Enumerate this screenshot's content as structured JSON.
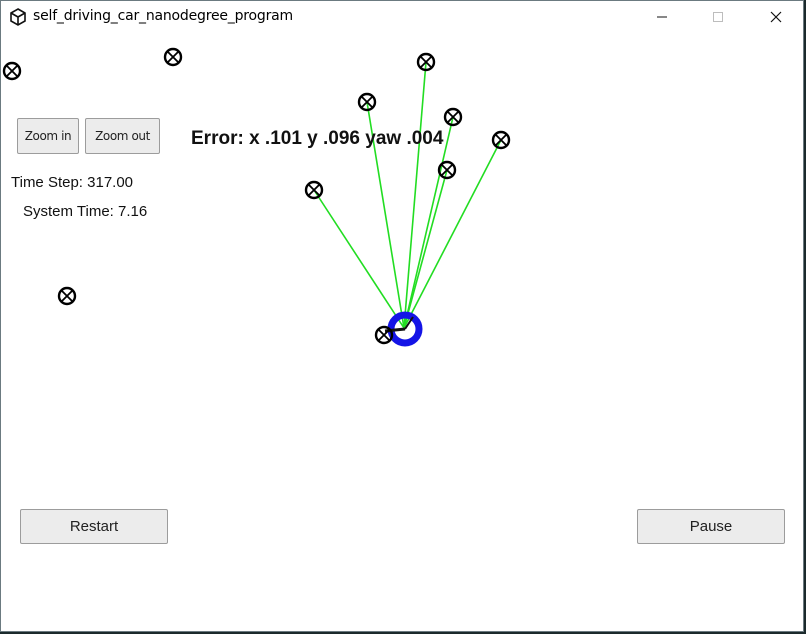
{
  "window": {
    "title": "self_driving_car_nanodegree_program",
    "app_icon": "unity-icon",
    "controls": [
      "minimize-icon",
      "maximize-icon",
      "close-icon"
    ]
  },
  "toolbar": {
    "zoom_in_label": "Zoom in",
    "zoom_out_label": "Zoom out"
  },
  "status": {
    "time_step": "Time Step: 317.00",
    "system_time": "System Time: 7.16"
  },
  "error_text": "Error: x .101 y .096 yaw .004",
  "footer": {
    "restart_label": "Restart",
    "pause_label": "Pause"
  },
  "colors": {
    "observation_line": "#22dd22",
    "vehicle": "#1414e6",
    "landmark": "#000000"
  }
}
